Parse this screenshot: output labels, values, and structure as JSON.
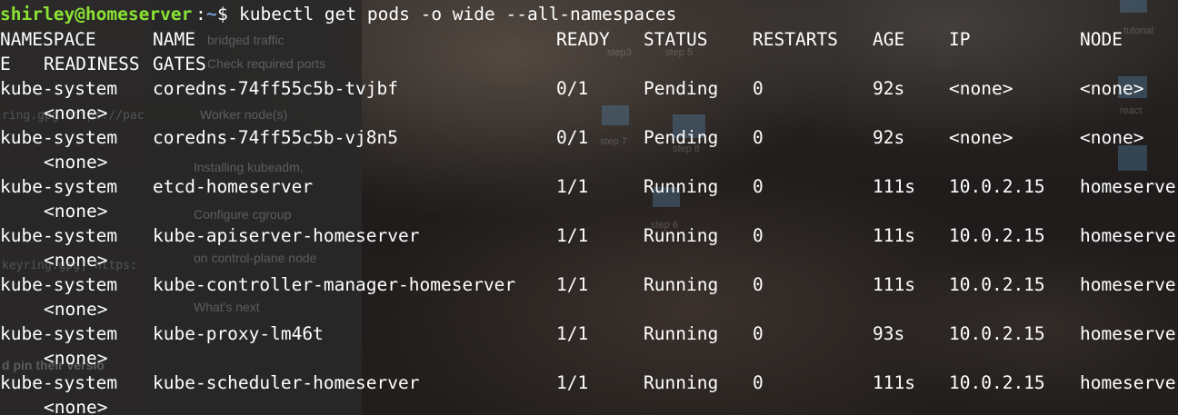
{
  "prompt": {
    "user_host": "shirley@homeserver",
    "sep": ":",
    "path": "~",
    "symbol": "$ ",
    "command": "kubectl get pods -o wide --all-namespaces"
  },
  "table": {
    "headers": {
      "namespace": "NAMESPACE",
      "name": "NAME",
      "ready": "READY",
      "status": "STATUS",
      "restarts": "RESTARTS",
      "age": "AGE",
      "ip": "IP",
      "node": "NODE",
      "wrap_prefix": "E",
      "readiness": "READINESS",
      "gates": "GATES"
    },
    "rows": [
      {
        "namespace": "kube-system",
        "name": "coredns-74ff55c5b-tvjbf",
        "ready": "0/1",
        "status": "Pending",
        "restarts": "0",
        "age": "92s",
        "ip": "<none>",
        "node": "<none>",
        "readiness": "<none>"
      },
      {
        "namespace": "kube-system",
        "name": "coredns-74ff55c5b-vj8n5",
        "ready": "0/1",
        "status": "Pending",
        "restarts": "0",
        "age": "92s",
        "ip": "<none>",
        "node": "<none>",
        "readiness": "<none>"
      },
      {
        "namespace": "kube-system",
        "name": "etcd-homeserver",
        "ready": "1/1",
        "status": "Running",
        "restarts": "0",
        "age": "111s",
        "ip": "10.0.2.15",
        "node": "homeserve",
        "readiness": "<none>"
      },
      {
        "namespace": "kube-system",
        "name": "kube-apiserver-homeserver",
        "ready": "1/1",
        "status": "Running",
        "restarts": "0",
        "age": "111s",
        "ip": "10.0.2.15",
        "node": "homeserve",
        "readiness": "<none>"
      },
      {
        "namespace": "kube-system",
        "name": "kube-controller-manager-homeserver",
        "ready": "1/1",
        "status": "Running",
        "restarts": "0",
        "age": "111s",
        "ip": "10.0.2.15",
        "node": "homeserve",
        "readiness": "<none>"
      },
      {
        "namespace": "kube-system",
        "name": "kube-proxy-lm46t",
        "ready": "1/1",
        "status": "Running",
        "restarts": "0",
        "age": "93s",
        "ip": "10.0.2.15",
        "node": "homeserve",
        "readiness": "<none>"
      },
      {
        "namespace": "kube-system",
        "name": "kube-scheduler-homeserver",
        "ready": "1/1",
        "status": "Running",
        "restarts": "0",
        "age": "111s",
        "ip": "10.0.2.15",
        "node": "homeserve",
        "readiness": "<none>"
      }
    ]
  },
  "background_doc": {
    "items": [
      "bridged traffic",
      "Check required ports",
      "Worker node(s)",
      "Installing kubeadm,",
      "Configure cgroup",
      "on control-plane node",
      "What's next"
    ],
    "code_fragments": [
      "ring.gpg https://pac",
      "keyring.gpg] https:",
      "d pin their versio"
    ],
    "diagram_labels": [
      "step3",
      "step 5",
      "step 7",
      "step 8",
      "step 6",
      "tutorial",
      "react"
    ]
  },
  "colors": {
    "prompt_user": "#8ae234",
    "prompt_path": "#729fcf",
    "text": "#ffffff"
  }
}
